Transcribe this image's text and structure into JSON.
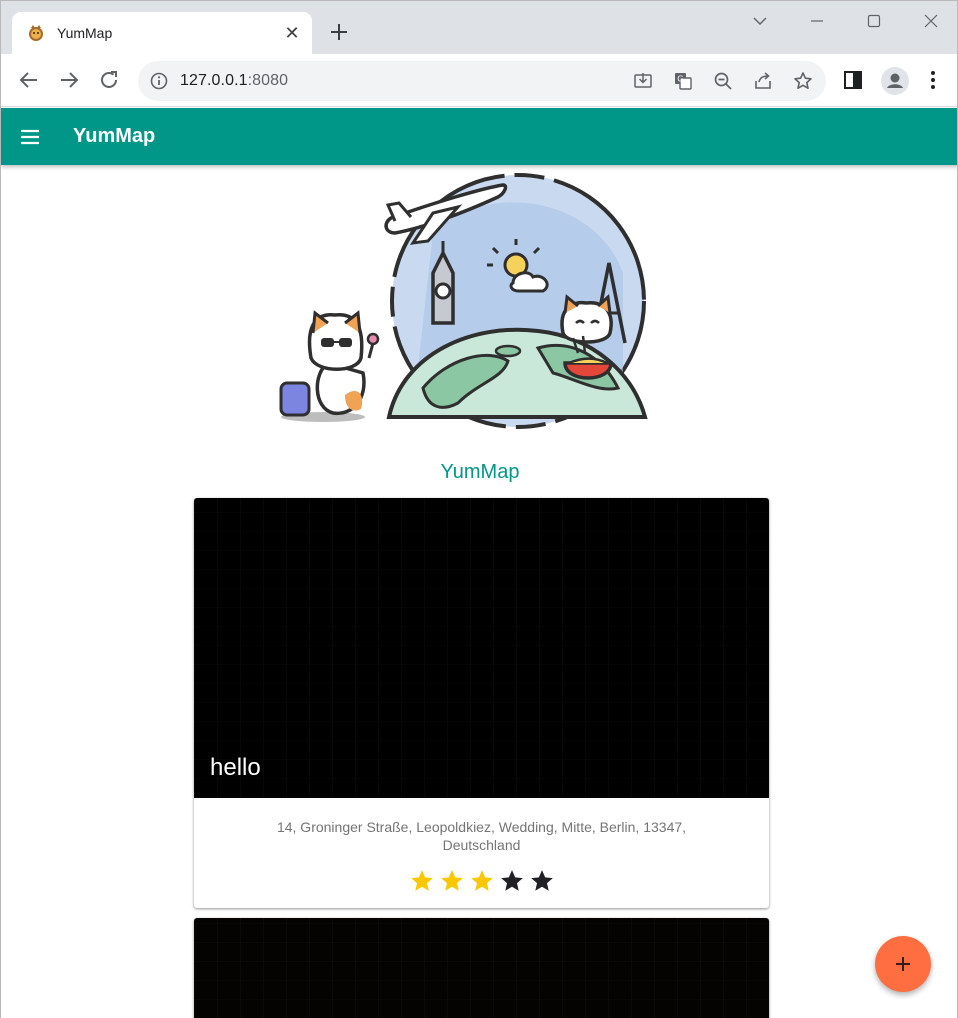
{
  "browser": {
    "tab_title": "YumMap",
    "url_host": "127.0.0.1",
    "url_port": ":8080"
  },
  "appbar": {
    "title": "YumMap",
    "color": "#009688"
  },
  "main": {
    "subtitle": "YumMap",
    "cards": [
      {
        "name": "hello",
        "address": "14, Groninger Straße, Leopoldkiez, Wedding, Mitte, Berlin, 13347, Deutschland",
        "rating": 3,
        "rating_max": 5
      }
    ]
  },
  "fab": {
    "icon": "plus-icon",
    "color": "#ff6e40"
  },
  "colors": {
    "star_filled": "#f9c800",
    "star_empty": "#202124"
  }
}
